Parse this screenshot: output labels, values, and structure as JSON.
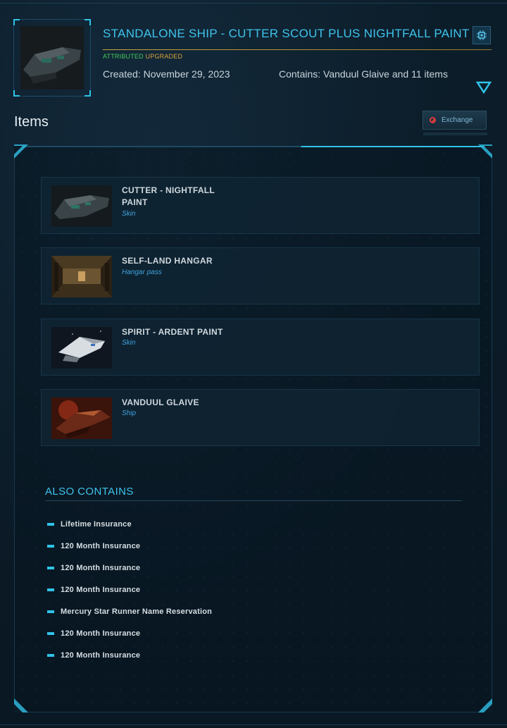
{
  "header": {
    "title": "STANDALONE SHIP - CUTTER SCOUT PLUS NIGHTFALL PAINT",
    "status_attributed": "ATTRIBUTED",
    "status_upgraded": "UPGRADED",
    "created": "Created: November 29, 2023",
    "contains": "Contains: Vanduul Glaive and 11 items",
    "chip_icon": "chip-icon",
    "expand_icon": "triangle-down-icon"
  },
  "items_section": {
    "title": "Items",
    "exchange_label": "Exchange",
    "exchange_icon": "no-entry-icon"
  },
  "items": [
    {
      "name": "CUTTER - NIGHTFALL PAINT",
      "type": "Skin"
    },
    {
      "name": "SELF-LAND HANGAR",
      "type": "Hangar pass"
    },
    {
      "name": "SPIRIT - ARDENT PAINT",
      "type": "Skin"
    },
    {
      "name": "VANDUUL GLAIVE",
      "type": "Ship"
    }
  ],
  "also_contains": {
    "title": "ALSO CONTAINS",
    "items": [
      "Lifetime Insurance",
      "120 Month Insurance",
      "120 Month Insurance",
      "120 Month Insurance",
      "Mercury Star Runner Name Reservation",
      "120 Month Insurance",
      "120 Month Insurance"
    ]
  },
  "colors": {
    "accent": "#3fc3ec",
    "attributed": "#46c85a",
    "upgraded": "#d9a23a",
    "danger": "#e03a3a"
  }
}
